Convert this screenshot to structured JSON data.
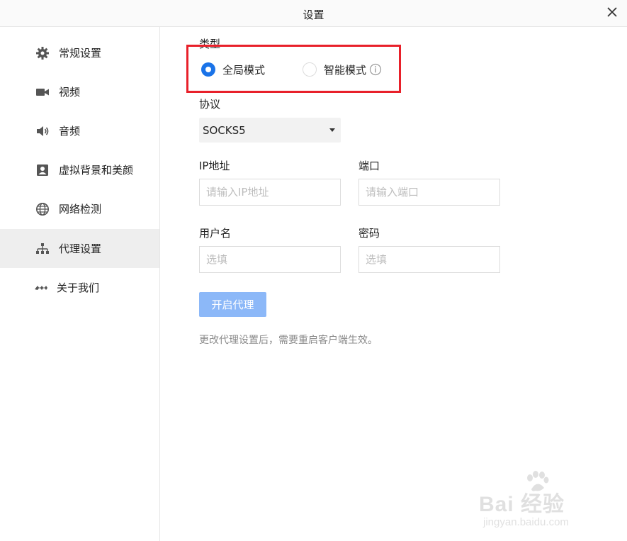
{
  "window": {
    "title": "设置"
  },
  "sidebar": {
    "items": [
      {
        "label": "常规设置",
        "icon": "gear-icon"
      },
      {
        "label": "视频",
        "icon": "video-camera-icon"
      },
      {
        "label": "音频",
        "icon": "speaker-icon"
      },
      {
        "label": "虚拟背景和美颜",
        "icon": "portrait-icon"
      },
      {
        "label": "网络检测",
        "icon": "globe-icon"
      },
      {
        "label": "代理设置",
        "icon": "network-tree-icon",
        "active": true
      },
      {
        "label": "关于我们",
        "icon": "logo-icon"
      }
    ]
  },
  "proxy": {
    "type_label": "类型",
    "modes": [
      {
        "label": "全局模式",
        "checked": true
      },
      {
        "label": "智能模式",
        "checked": false
      }
    ],
    "protocol_label": "协议",
    "protocol_value": "SOCKS5",
    "ip_label": "IP地址",
    "ip_placeholder": "请输入IP地址",
    "port_label": "端口",
    "port_placeholder": "请输入端口",
    "user_label": "用户名",
    "user_placeholder": "选填",
    "password_label": "密码",
    "password_placeholder": "选填",
    "enable_button": "开启代理",
    "hint": "更改代理设置后，需要重启客户端生效。"
  },
  "watermark": {
    "brand": "Bai 经验",
    "sub": "jingyan.baidu.com"
  },
  "colors": {
    "accent": "#1a73e8",
    "button": "#8cb8f8",
    "highlight": "#e8202a",
    "active_nav": "#eeeeee"
  }
}
